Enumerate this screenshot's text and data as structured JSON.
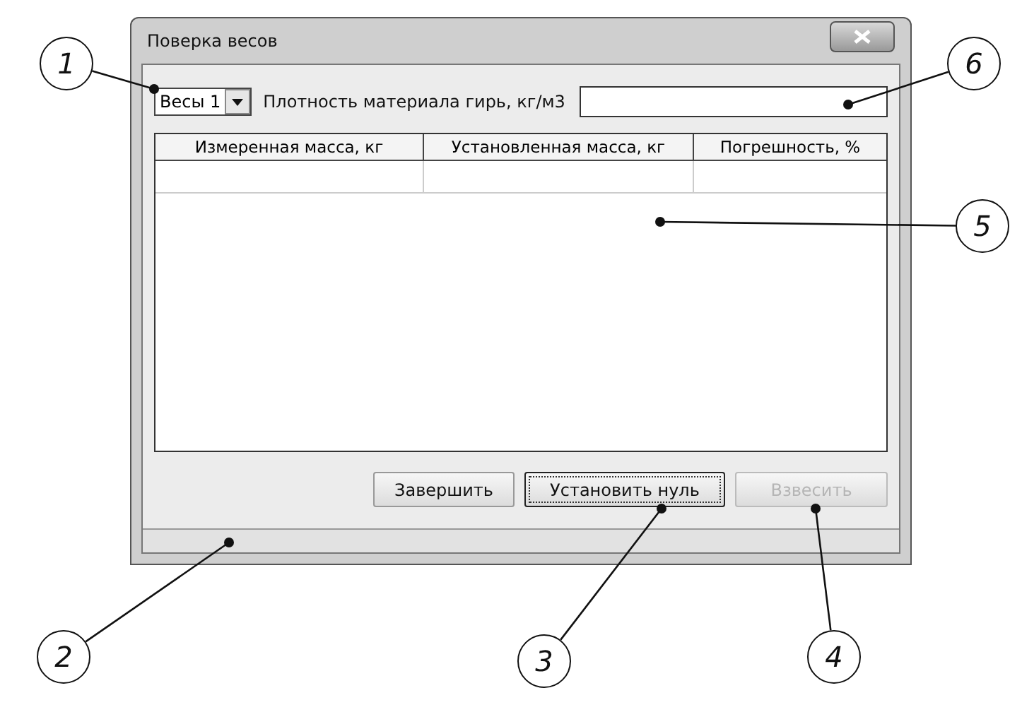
{
  "window": {
    "title": "Поверка весов"
  },
  "scale_select": {
    "value": "Весы 1"
  },
  "density": {
    "label": "Плотность материала гирь, кг/м3"
  },
  "table": {
    "columns": [
      "Измеренная масса, кг",
      "Установленная масса, кг",
      "Погрешность, %"
    ]
  },
  "buttons": [
    {
      "label": "Завершить",
      "focused": false,
      "disabled": false
    },
    {
      "label": "Установить нуль",
      "focused": true,
      "disabled": false
    },
    {
      "label": "Взвесить",
      "focused": false,
      "disabled": true
    }
  ],
  "callouts": [
    {
      "number": "1"
    },
    {
      "number": "6"
    },
    {
      "number": "5"
    },
    {
      "number": "2"
    },
    {
      "number": "3"
    },
    {
      "number": "4"
    }
  ]
}
